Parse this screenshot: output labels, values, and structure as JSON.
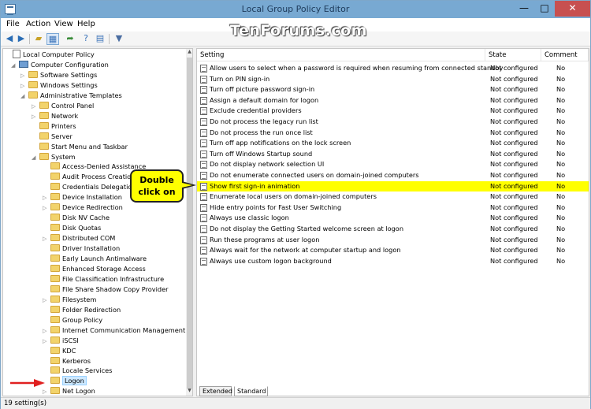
{
  "window": {
    "title": "Local Group Policy Editor",
    "min_glyph": "—",
    "max_glyph": "□",
    "close_glyph": "✕"
  },
  "watermark": "TenForums.com",
  "menu": [
    {
      "label": "File",
      "access": "F"
    },
    {
      "label": "Action",
      "access": "A"
    },
    {
      "label": "View",
      "access": "V"
    },
    {
      "label": "Help",
      "access": "H"
    }
  ],
  "toolbar": {
    "icons": [
      "back-arrow-icon",
      "forward-arrow-icon",
      "up-folder-icon",
      "show-hide-tree-icon",
      "export-list-icon",
      "help-icon",
      "properties-icon",
      "filter-icon"
    ],
    "glyphs": {
      "back": "◀",
      "forward": "▶",
      "folder": "▰",
      "pane": "▦",
      "export": "➦",
      "help": "?",
      "props": "▤",
      "filter": "▼"
    }
  },
  "tree": {
    "items": [
      {
        "label": "Local Computer Policy",
        "level": 0,
        "icon": "policy-doc",
        "expander": ""
      },
      {
        "label": "Computer Configuration",
        "level": 1,
        "icon": "computer",
        "expander": "◢"
      },
      {
        "label": "Software Settings",
        "level": 2,
        "icon": "folder",
        "expander": "▷"
      },
      {
        "label": "Windows Settings",
        "level": 2,
        "icon": "folder",
        "expander": "▷"
      },
      {
        "label": "Administrative Templates",
        "level": 2,
        "icon": "folder",
        "expander": "◢"
      },
      {
        "label": "Control Panel",
        "level": 3,
        "icon": "folder",
        "expander": "▷"
      },
      {
        "label": "Network",
        "level": 3,
        "icon": "folder",
        "expander": "▷"
      },
      {
        "label": "Printers",
        "level": 3,
        "icon": "folder",
        "expander": ""
      },
      {
        "label": "Server",
        "level": 3,
        "icon": "folder",
        "expander": ""
      },
      {
        "label": "Start Menu and Taskbar",
        "level": 3,
        "icon": "folder",
        "expander": ""
      },
      {
        "label": "System",
        "level": 3,
        "icon": "folder",
        "expander": "◢"
      },
      {
        "label": "Access-Denied Assistance",
        "level": 4,
        "icon": "folder",
        "expander": ""
      },
      {
        "label": "Audit Process Creation",
        "level": 4,
        "icon": "folder",
        "expander": ""
      },
      {
        "label": "Credentials Delegation",
        "level": 4,
        "icon": "folder",
        "expander": ""
      },
      {
        "label": "Device Installation",
        "level": 4,
        "icon": "folder",
        "expander": "▷"
      },
      {
        "label": "Device Redirection",
        "level": 4,
        "icon": "folder",
        "expander": "▷"
      },
      {
        "label": "Disk NV Cache",
        "level": 4,
        "icon": "folder",
        "expander": ""
      },
      {
        "label": "Disk Quotas",
        "level": 4,
        "icon": "folder",
        "expander": ""
      },
      {
        "label": "Distributed COM",
        "level": 4,
        "icon": "folder",
        "expander": "▷"
      },
      {
        "label": "Driver Installation",
        "level": 4,
        "icon": "folder",
        "expander": ""
      },
      {
        "label": "Early Launch Antimalware",
        "level": 4,
        "icon": "folder",
        "expander": ""
      },
      {
        "label": "Enhanced Storage Access",
        "level": 4,
        "icon": "folder",
        "expander": ""
      },
      {
        "label": "File Classification Infrastructure",
        "level": 4,
        "icon": "folder",
        "expander": ""
      },
      {
        "label": "File Share Shadow Copy Provider",
        "level": 4,
        "icon": "folder",
        "expander": ""
      },
      {
        "label": "Filesystem",
        "level": 4,
        "icon": "folder",
        "expander": "▷"
      },
      {
        "label": "Folder Redirection",
        "level": 4,
        "icon": "folder",
        "expander": ""
      },
      {
        "label": "Group Policy",
        "level": 4,
        "icon": "folder",
        "expander": ""
      },
      {
        "label": "Internet Communication Management",
        "level": 4,
        "icon": "folder",
        "expander": "▷"
      },
      {
        "label": "iSCSI",
        "level": 4,
        "icon": "folder",
        "expander": "▷"
      },
      {
        "label": "KDC",
        "level": 4,
        "icon": "folder",
        "expander": ""
      },
      {
        "label": "Kerberos",
        "level": 4,
        "icon": "folder",
        "expander": ""
      },
      {
        "label": "Locale Services",
        "level": 4,
        "icon": "folder",
        "expander": ""
      },
      {
        "label": "Logon",
        "level": 4,
        "icon": "folder",
        "expander": "",
        "selected": true
      },
      {
        "label": "Net Logon",
        "level": 4,
        "icon": "folder",
        "expander": "▷"
      }
    ]
  },
  "list": {
    "columns": {
      "setting": "Setting",
      "state": "State",
      "comment": "Comment"
    },
    "rows": [
      {
        "setting": "Allow users to select when a password is required when resuming from connected standby",
        "state": "Not configured",
        "comment": "No"
      },
      {
        "setting": "Turn on PIN sign-in",
        "state": "Not configured",
        "comment": "No"
      },
      {
        "setting": "Turn off picture password sign-in",
        "state": "Not configured",
        "comment": "No"
      },
      {
        "setting": "Assign a default domain for logon",
        "state": "Not configured",
        "comment": "No"
      },
      {
        "setting": "Exclude credential providers",
        "state": "Not configured",
        "comment": "No"
      },
      {
        "setting": "Do not process the legacy run list",
        "state": "Not configured",
        "comment": "No"
      },
      {
        "setting": "Do not process the run once list",
        "state": "Not configured",
        "comment": "No"
      },
      {
        "setting": "Turn off app notifications on the lock screen",
        "state": "Not configured",
        "comment": "No"
      },
      {
        "setting": "Turn off Windows Startup sound",
        "state": "Not configured",
        "comment": "No"
      },
      {
        "setting": "Do not display network selection UI",
        "state": "Not configured",
        "comment": "No"
      },
      {
        "setting": "Do not enumerate connected users on domain-joined computers",
        "state": "Not configured",
        "comment": "No"
      },
      {
        "setting": "Show first sign-in animation",
        "state": "Not configured",
        "comment": "No",
        "highlighted": true
      },
      {
        "setting": "Enumerate local users on domain-joined computers",
        "state": "Not configured",
        "comment": "No"
      },
      {
        "setting": "Hide entry points for Fast User Switching",
        "state": "Not configured",
        "comment": "No"
      },
      {
        "setting": "Always use classic logon",
        "state": "Not configured",
        "comment": "No"
      },
      {
        "setting": "Do not display the Getting Started welcome screen at logon",
        "state": "Not configured",
        "comment": "No"
      },
      {
        "setting": "Run these programs at user logon",
        "state": "Not configured",
        "comment": "No"
      },
      {
        "setting": "Always wait for the network at computer startup and logon",
        "state": "Not configured",
        "comment": "No"
      },
      {
        "setting": "Always use custom logon background",
        "state": "Not configured",
        "comment": "No"
      }
    ]
  },
  "tabs": [
    {
      "label": "Extended",
      "active": false
    },
    {
      "label": "Standard",
      "active": true
    }
  ],
  "status": "19 setting(s)",
  "callout": {
    "line1": "Double",
    "line2": "click on"
  },
  "colors": {
    "highlight": "#ffff00",
    "annotation_red": "#e02020",
    "title_bar": "#78a9d2"
  }
}
